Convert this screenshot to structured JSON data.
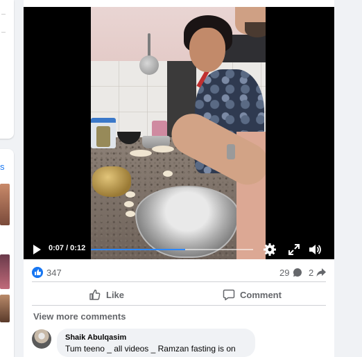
{
  "left_panel": {
    "fragment_text": "s"
  },
  "video": {
    "time_display": "0:07 / 0:12",
    "progress_fraction": 0.583,
    "controls": [
      "play-icon",
      "settings-icon",
      "fullscreen-icon",
      "expand-icon",
      "volume-icon"
    ]
  },
  "reactions": {
    "like_count": "347",
    "comment_count": "29",
    "share_count": "2"
  },
  "actions": {
    "like_label": "Like",
    "comment_label": "Comment"
  },
  "comments": {
    "view_more": "View more comments",
    "items": [
      {
        "author": "Shaik Abulqasim",
        "text": "Tum teeno _ all videos _ Ramzan fasting is on"
      }
    ]
  },
  "colors": {
    "accent": "#1877f2",
    "progress": "#2d88ff",
    "muted_text": "#65676b"
  }
}
